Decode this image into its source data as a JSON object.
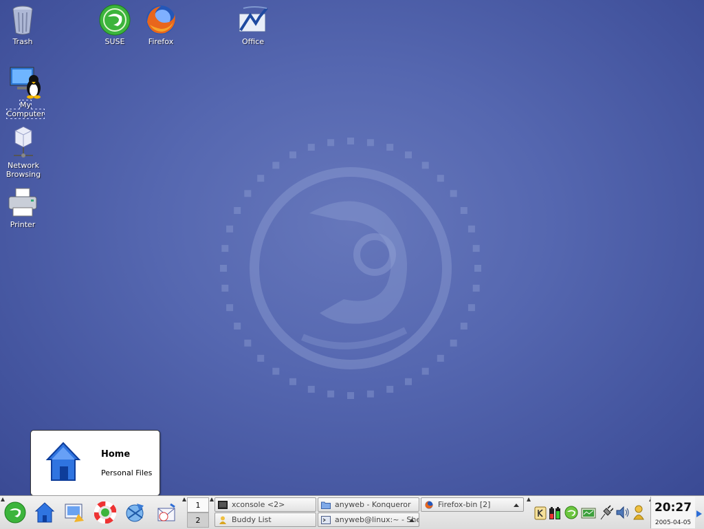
{
  "desktop": {
    "icons": [
      {
        "label": "Trash"
      },
      {
        "label": "SUSE"
      },
      {
        "label": "Firefox"
      },
      {
        "label": "Office"
      },
      {
        "label_line1": "My",
        "label_line2": "Computer"
      },
      {
        "label_line1": "Network",
        "label_line2": "Browsing"
      },
      {
        "label": "Printer"
      }
    ]
  },
  "tooltip": {
    "title": "Home",
    "description": "Personal Files"
  },
  "taskbar": {
    "quick_launch": [
      "suse-menu-icon",
      "home-icon",
      "desktop-icon",
      "help-lifebuoy-icon",
      "konqueror-icon",
      "mail-calendar-icon"
    ],
    "pager": [
      "1",
      "2"
    ],
    "tasks": [
      {
        "label": "xconsole <2>"
      },
      {
        "label": "anyweb - Konqueror"
      },
      {
        "label": "Firefox-bin [2]"
      },
      {
        "label": "Buddy List"
      },
      {
        "label": "anyweb@linux:~ - Shell"
      }
    ],
    "tray_icons": [
      "kde-k-icon",
      "battery-icon",
      "suse-updater-icon",
      "network-monitor-icon",
      "plug-icon",
      "speaker-icon",
      "user-icon"
    ],
    "clock": {
      "time": "20:27",
      "date": "2005-04-05"
    }
  },
  "colors": {
    "desktop_bg": "#5567b0",
    "taskbar_bg": "#e8e8e8",
    "suse_green": "#3cb43c"
  }
}
